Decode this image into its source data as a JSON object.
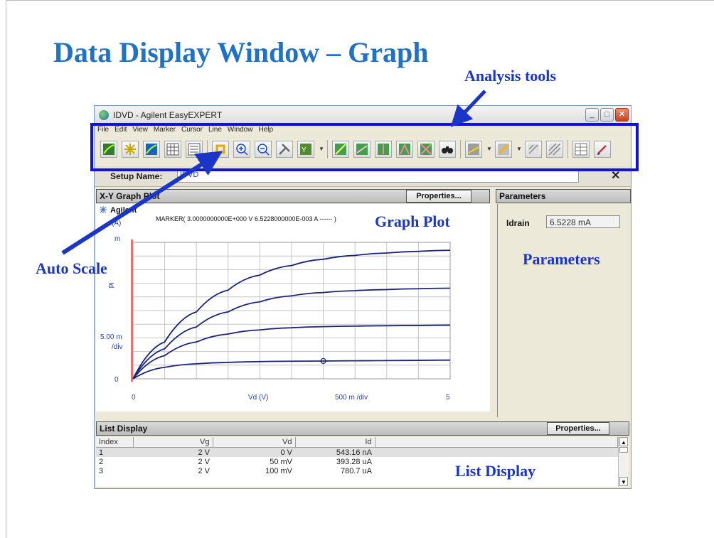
{
  "slide": {
    "title": "Data Display Window – Graph",
    "callouts": {
      "analysis_tools": "Analysis tools",
      "auto_scale": "Auto Scale",
      "graph_plot": "Graph Plot",
      "parameters": "Parameters",
      "list_display": "List Display"
    }
  },
  "window": {
    "title": "IDVD - Agilent EasyEXPERT",
    "menu": [
      "File",
      "Edit",
      "View",
      "Marker",
      "Cursor",
      "Line",
      "Window",
      "Help"
    ],
    "toolbar_icons": [
      "graph-icon",
      "sparkle-icon",
      "auto-scale-graph-icon",
      "grid-icon",
      "list-icon",
      "crop-icon",
      "zoom-in-icon",
      "zoom-out-icon",
      "tools-icon",
      "y-axis-icon",
      "line-fit-icon",
      "line-tangent-icon",
      "line-regression-icon",
      "line-through-icon",
      "line-cross-icon",
      "binoculars-icon",
      "overlay-icon",
      "slope-icon",
      "scale-icon",
      "hatch-icon",
      "table-icon",
      "pen-icon"
    ],
    "setup_label": "Setup Name:",
    "setup_value": "IDVD"
  },
  "graph_panel": {
    "header": "X-Y Graph Plot",
    "properties_label": "Properties...",
    "brand": "Agilent",
    "unit": "(A)",
    "marker_text": "MARKER(  3.0000000000E+000 V   6.5228000000E-003 A   ------ )",
    "y_top_label": "m",
    "y_axis_label": "Id",
    "y_div_label": "5.00 m",
    "y_div_unit": "/div",
    "y_zero_label": "0",
    "x_zero_label": "0",
    "x_axis_label": "Vd  (V)",
    "x_div_label": "500 m /div",
    "x_max_label": "5"
  },
  "params_panel": {
    "header": "Parameters",
    "param_name": "Idrain",
    "param_value": "6.5228 mA"
  },
  "list_panel": {
    "header": "List Display",
    "properties_label": "Properties...",
    "columns": [
      "Index",
      "Vg",
      "Vd",
      "Id"
    ],
    "rows": [
      [
        "1",
        "2 V",
        "0 V",
        "543.16 nA"
      ],
      [
        "2",
        "2 V",
        "50 mV",
        "393.28 uA"
      ],
      [
        "3",
        "2 V",
        "100 mV",
        "780.7 uA"
      ]
    ]
  },
  "colors": {
    "title_blue": "#1f72c6",
    "callout_blue": "#1a35c8",
    "curve_navy": "#1a237e",
    "y_axis_red": "#e57373"
  },
  "chart_data": {
    "type": "line",
    "x": [
      0,
      0.5,
      1,
      1.5,
      2,
      2.5,
      3,
      3.5,
      4,
      4.5,
      5
    ],
    "series": [
      {
        "values": [
          0,
          4.2,
          5.5,
          6.0,
          6.3,
          6.45,
          6.52,
          6.6,
          6.68,
          6.76,
          6.85
        ]
      },
      {
        "values": [
          0,
          8.5,
          13.5,
          16.4,
          17.9,
          18.7,
          19.1,
          19.3,
          19.45,
          19.55,
          19.65
        ]
      },
      {
        "values": [
          0,
          11.0,
          19.0,
          24.5,
          28.2,
          30.4,
          31.6,
          32.3,
          32.7,
          33.0,
          33.2
        ]
      },
      {
        "values": [
          0,
          13.5,
          24.5,
          32.5,
          38.0,
          41.5,
          43.8,
          45.2,
          46.1,
          46.7,
          47.1
        ]
      }
    ],
    "xlabel": "Vd  (V)",
    "ylabel": "Id",
    "xlim": [
      0,
      5
    ],
    "ylim": [
      0,
      50
    ],
    "marker": {
      "x": 3.0,
      "y": 6.5228
    },
    "grid": true
  }
}
